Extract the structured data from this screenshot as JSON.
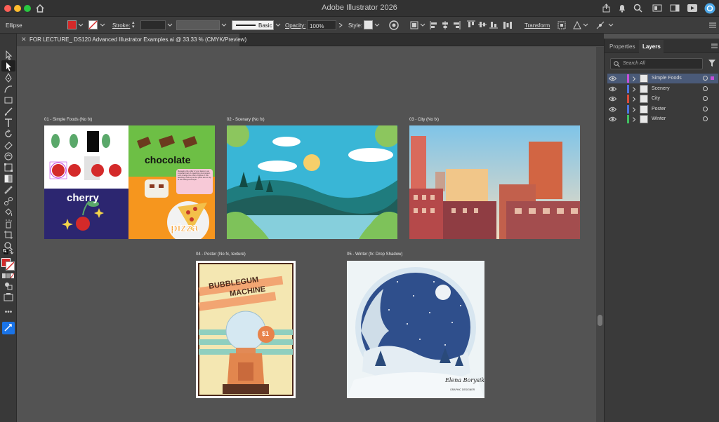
{
  "window": {
    "title": "Adobe Illustrator 2026"
  },
  "control_bar": {
    "selection_type": "Ellipse",
    "stroke_label": "Stroke:",
    "brush_style": "Basic",
    "opacity_label": "Opacity:",
    "opacity_value": "100%",
    "style_label": "Style:",
    "transform_label": "Transform",
    "fill_color": "#d42a2a"
  },
  "document_tab": {
    "title": "FOR LECTURE_ DS120 Advanced Illustrator Examples.ai @ 33.33 % (CMYK/Preview)"
  },
  "artboards": [
    {
      "label": "01 - Simple Foods (No fx)"
    },
    {
      "label": "02 - Scenary (No fx)"
    },
    {
      "label": "03 - City (No fx)"
    },
    {
      "label": "04 - Poster (No fx, texture)"
    },
    {
      "label": "05 - Winter (fx: Drop Shadow)"
    }
  ],
  "art_text": {
    "chocolate": "chocolate",
    "cherry": "cherry",
    "pizza": "pizza",
    "note": "Managing the order of your layers is an important part of organizing your project. Let's change the order of layers in this teaching mock-up so the pizza sits on top of the background layer",
    "poster_line1": "BUBBLEGUM",
    "poster_line2": "MACHINE",
    "poster_price": "$1",
    "signature": "Elena Borysikhina",
    "signature_sub": "GRAPHIC DESIGNER"
  },
  "panel": {
    "tabs": [
      "Properties",
      "Layers"
    ],
    "search_placeholder": "Search All",
    "layers": [
      {
        "name": "Simple Foods",
        "color": "#c64fd8",
        "selected": true
      },
      {
        "name": "Scenery",
        "color": "#4d74e0",
        "selected": false
      },
      {
        "name": "City",
        "color": "#d94a3a",
        "selected": false
      },
      {
        "name": "Poster",
        "color": "#4d74e0",
        "selected": false
      },
      {
        "name": "Winter",
        "color": "#40c060",
        "selected": false
      }
    ]
  }
}
